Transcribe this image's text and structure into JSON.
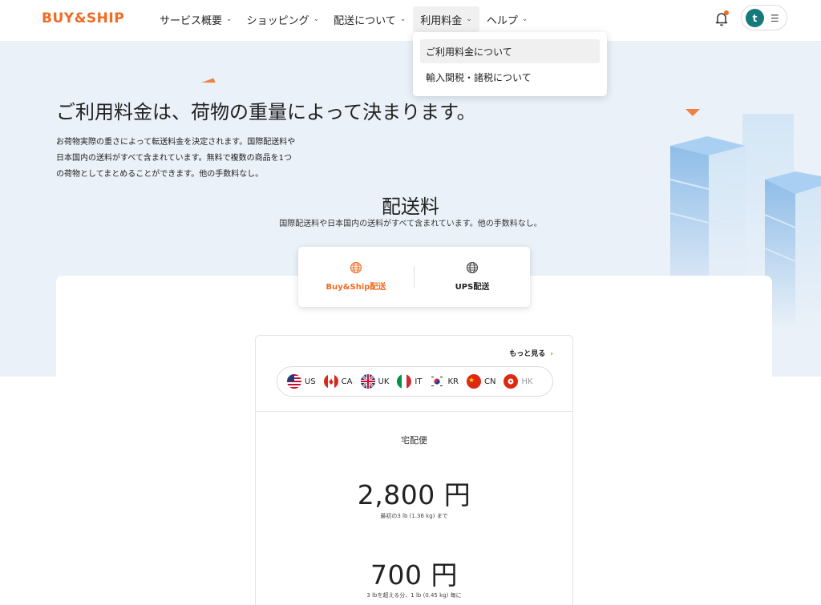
{
  "header": {
    "logo": "BUY&SHIP",
    "nav": [
      {
        "label": "サービス概要"
      },
      {
        "label": "ショッピング"
      },
      {
        "label": "配送について"
      },
      {
        "label": "利用料金"
      },
      {
        "label": "ヘルプ"
      }
    ],
    "avatar_initial": "t",
    "menu_icon": "☰",
    "chevron": "⌄"
  },
  "dropdown": {
    "items": [
      {
        "label": "ご利用料金について"
      },
      {
        "label": "輸入関税・諸税について"
      }
    ]
  },
  "hero": {
    "title": "ご利用料金は、荷物の重量によって決まります。",
    "desc": [
      "お荷物実際の重さによって転送料金を決定されます。国際配送料や",
      "日本国内の送料がすべて含まれています。無料で複数の商品を1つ",
      "の荷物としてまとめることができます。他の手数料なし。"
    ]
  },
  "section": {
    "title": "配送料",
    "subtitle": "国際配送料や日本国内の送料がすべて含まれています。他の手数料なし。"
  },
  "shipping_tabs": [
    {
      "label": "Buy&Ship配送",
      "icon": "globe-icon"
    },
    {
      "label": "UPS配送",
      "icon": "globe-icon"
    }
  ],
  "rates": {
    "more_label": "もっと見る",
    "more_arrow": "›",
    "countries": [
      {
        "code": "US"
      },
      {
        "code": "CA"
      },
      {
        "code": "UK"
      },
      {
        "code": "IT"
      },
      {
        "code": "KR"
      },
      {
        "code": "CN"
      },
      {
        "code": "HK"
      }
    ],
    "service": "宅配便",
    "first_price": "2,800 円",
    "first_note": "最初の3 lb (1.36 kg) まで",
    "additional_price": "700 円",
    "additional_note": "3 lbを超える分、1 lb (0.45 kg) 毎に"
  },
  "colors": {
    "brand": "#f26b21",
    "hero_bg": "#eaf1f8",
    "avatar": "#147a7d"
  }
}
